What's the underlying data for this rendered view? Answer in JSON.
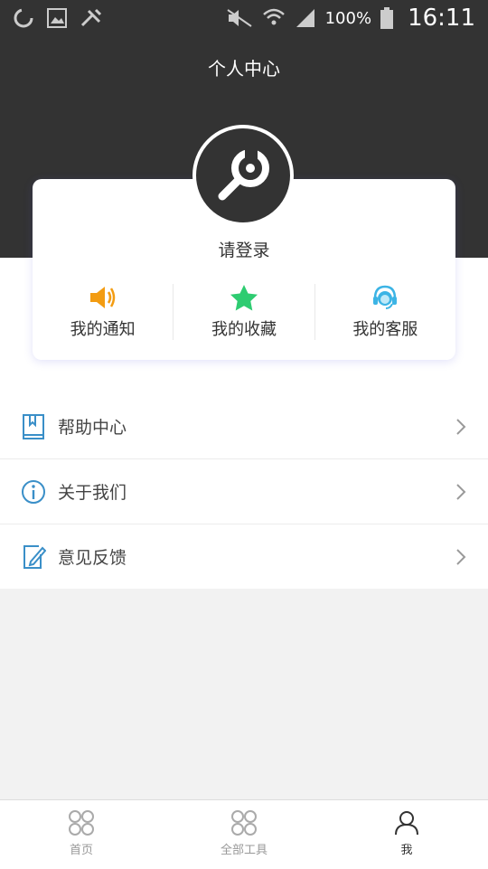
{
  "status_bar": {
    "battery_percent": "100%",
    "time": "16:11"
  },
  "header": {
    "title": "个人中心"
  },
  "profile": {
    "login_label": "请登录",
    "actions": [
      {
        "label": "我的通知",
        "icon": "speaker-icon",
        "color": "#f39c12"
      },
      {
        "label": "我的收藏",
        "icon": "star-icon",
        "color": "#2ecc71"
      },
      {
        "label": "我的客服",
        "icon": "headset-icon",
        "color": "#3cb4e5"
      }
    ]
  },
  "menu": {
    "items": [
      {
        "label": "帮助中心",
        "icon": "book-icon"
      },
      {
        "label": "关于我们",
        "icon": "info-icon"
      },
      {
        "label": "意见反馈",
        "icon": "edit-icon"
      }
    ]
  },
  "tabbar": {
    "tabs": [
      {
        "label": "首页",
        "icon": "grid-icon",
        "active": false
      },
      {
        "label": "全部工具",
        "icon": "grid-icon",
        "active": false
      },
      {
        "label": "我",
        "icon": "user-icon",
        "active": true
      }
    ]
  },
  "colors": {
    "header_bg": "#333333",
    "icon_blue": "#3a8fc8"
  }
}
